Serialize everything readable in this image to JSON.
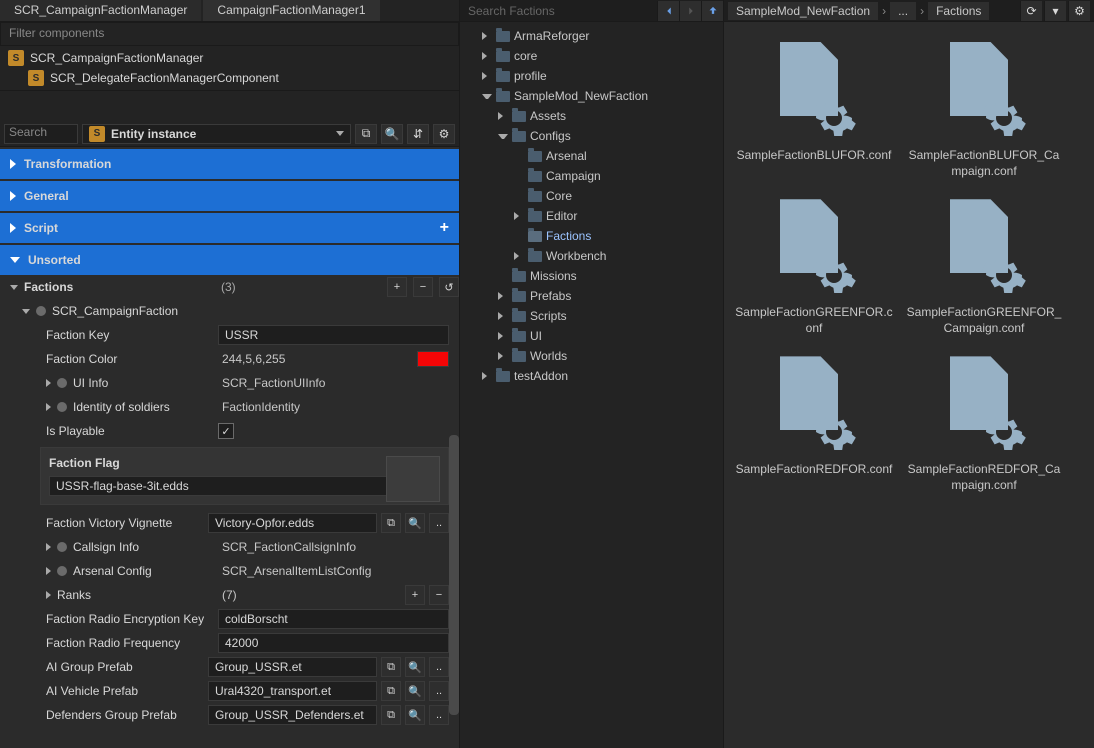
{
  "tabs": {
    "left": "SCR_CampaignFactionManager",
    "right": "CampaignFactionManager1"
  },
  "filter_placeholder": "Filter components",
  "components": {
    "root": "SCR_CampaignFactionManager",
    "child": "SCR_DelegateFactionManagerComponent"
  },
  "search_placeholder": "Search",
  "entity_selector": "Entity instance",
  "sections": {
    "transformation": "Transformation",
    "general": "General",
    "script": "Script",
    "unsorted": "Unsorted"
  },
  "factions": {
    "label": "Factions",
    "count": "(3)",
    "item": "SCR_CampaignFaction",
    "props": {
      "faction_key_l": "Faction Key",
      "faction_key_v": "USSR",
      "faction_color_l": "Faction Color",
      "faction_color_v": "244,5,6,255",
      "ui_info_l": "UI Info",
      "ui_info_v": "SCR_FactionUIInfo",
      "identity_l": "Identity of soldiers",
      "identity_v": "FactionIdentity",
      "playable_l": "Is Playable",
      "flag_l": "Faction Flag",
      "flag_v": "USSR-flag-base-3it.edds",
      "victory_l": "Faction Victory Vignette",
      "victory_v": "Victory-Opfor.edds",
      "callsign_l": "Callsign Info",
      "callsign_v": "SCR_FactionCallsignInfo",
      "arsenal_l": "Arsenal Config",
      "arsenal_v": "SCR_ArsenalItemListConfig",
      "ranks_l": "Ranks",
      "ranks_v": "(7)",
      "encrypt_l": "Faction Radio Encryption Key",
      "encrypt_v": "coldBorscht",
      "freq_l": "Faction Radio Frequency",
      "freq_v": "42000",
      "aigroup_l": "AI Group Prefab",
      "aigroup_v": "Group_USSR.et",
      "aiveh_l": "AI Vehicle Prefab",
      "aiveh_v": "Ural4320_transport.et",
      "defend_l": "Defenders Group Prefab",
      "defend_v": "Group_USSR_Defenders.et"
    }
  },
  "tree_search": "Search Factions",
  "tree": {
    "arma": "ArmaReforger",
    "core": "core",
    "profile": "profile",
    "sample": "SampleMod_NewFaction",
    "assets": "Assets",
    "configs": "Configs",
    "arsenal": "Arsenal",
    "campaign": "Campaign",
    "coreCfg": "Core",
    "editor": "Editor",
    "factions": "Factions",
    "workbench": "Workbench",
    "missions": "Missions",
    "prefabs": "Prefabs",
    "scripts": "Scripts",
    "ui": "UI",
    "worlds": "Worlds",
    "testaddon": "testAddon"
  },
  "breadcrumbs": {
    "root": "SampleMod_NewFaction",
    "mid": "...",
    "leaf": "Factions"
  },
  "files": [
    "SampleFactionBLUFOR.conf",
    "SampleFactionBLUFOR_Campaign.conf",
    "SampleFactionGREENFOR.conf",
    "SampleFactionGREENFOR_Campaign.conf",
    "SampleFactionREDFOR.conf",
    "SampleFactionREDFOR_Campaign.conf"
  ]
}
